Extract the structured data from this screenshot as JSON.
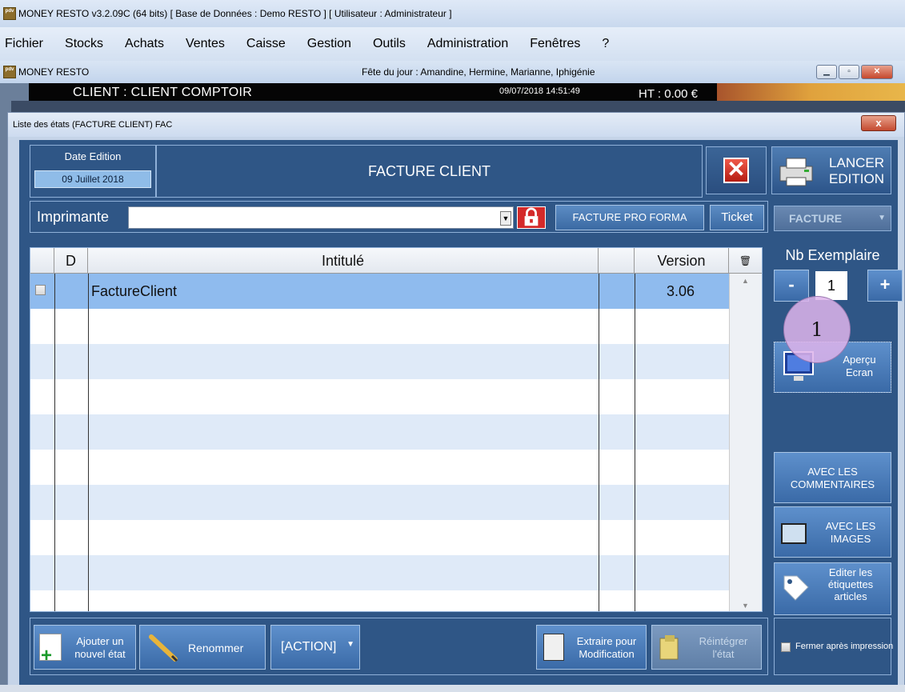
{
  "app": {
    "title": "MONEY RESTO v3.2.09C (64 bits) [ Base de Données : Demo RESTO ] [ Utilisateur : Administrateur ]",
    "logo": "MONEY pdv"
  },
  "menu": [
    "Fichier",
    "Stocks",
    "Achats",
    "Ventes",
    "Caisse",
    "Gestion",
    "Outils",
    "Administration",
    "Fenêtres",
    "?"
  ],
  "mdi": {
    "title": "MONEY RESTO",
    "fete": "Fête du jour : Amandine, Hermine, Marianne, Iphigénie"
  },
  "client_bar": {
    "client": "CLIENT : CLIENT COMPTOIR",
    "datetime": "09/07/2018 14:51:49",
    "ht": "HT : 0.00 €"
  },
  "dialog": {
    "title": "Liste des états (FACTURE CLIENT) FAC",
    "close": "x",
    "date_label": "Date Edition",
    "date_value": "09 Juillet 2018",
    "header_title": "FACTURE CLIENT",
    "lancer_label": "LANCER EDITION",
    "imprimante_label": "Imprimante",
    "imprimante_value": "",
    "proforma_label": "FACTURE PRO FORMA",
    "ticket_label": "Ticket",
    "facture_dd": "FACTURE",
    "grid": {
      "columns": [
        "D",
        "Intitulé",
        "Version"
      ],
      "rows": [
        {
          "checked": false,
          "d": "",
          "intitule": "FactureClient",
          "version": "3.06"
        }
      ]
    },
    "nb_exemplaire_label": "Nb Exemplaire",
    "nb_exemplaire": "1",
    "minus_label": "-",
    "plus_label": "+",
    "badge": "1",
    "apercu_label": "Aperçu Ecran",
    "avec_commentaires": "AVEC LES COMMENTAIRES",
    "avec_images": "AVEC LES IMAGES",
    "etiquettes": "Editer les étiquettes articles",
    "ajouter": "Ajouter un nouvel état",
    "renommer": "Renommer",
    "action": "[ACTION]",
    "extraire": "Extraire pour Modification",
    "reintegrer": "Réintégrer l'état",
    "fermer": "Fermer après impression"
  },
  "colors": {
    "panel_bg": "#2f5686",
    "button": "#4a7bb8",
    "selected_row": "#8fbbee",
    "alt_row": "#dfeaf8"
  }
}
